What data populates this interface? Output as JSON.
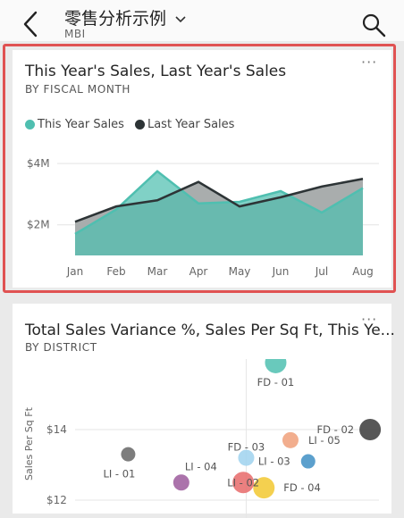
{
  "header": {
    "title": "零售分析示例",
    "subtitle": "MBI"
  },
  "colors": {
    "this_year": "#4fbfb0",
    "last_year": "#2d3436",
    "highlight": "#e05252"
  },
  "tile1": {
    "title": "This Year's Sales, Last Year's Sales",
    "subtitle": "BY FISCAL MONTH",
    "more": "···",
    "legend": [
      {
        "label": "This Year Sales",
        "color": "#4fbfb0"
      },
      {
        "label": "Last Year Sales",
        "color": "#2d3436"
      }
    ]
  },
  "chart_data": [
    {
      "type": "area",
      "categories": [
        "Jan",
        "Feb",
        "Mar",
        "Apr",
        "May",
        "Jun",
        "Jul",
        "Aug"
      ],
      "series": [
        {
          "name": "This Year Sales",
          "values": [
            1.7,
            2.5,
            3.75,
            2.7,
            2.75,
            3.1,
            2.4,
            3.2
          ]
        },
        {
          "name": "Last Year Sales",
          "values": [
            2.1,
            2.6,
            2.8,
            3.4,
            2.6,
            2.9,
            3.25,
            3.5
          ]
        }
      ],
      "yticks": [
        "$2M",
        "$4M"
      ],
      "ytick_values": [
        2,
        4
      ],
      "ylim": [
        1.0,
        4.5
      ],
      "grid": true,
      "legend_position": "top-left"
    },
    {
      "type": "scatter",
      "ylabel": "Sales Per Sq Ft",
      "yticks": [
        "$14",
        "$12"
      ],
      "ytick_values": [
        14,
        12
      ],
      "ylim": [
        12,
        16
      ],
      "points": [
        {
          "label": "FD - 01",
          "x": 1.0,
          "y": 15.9,
          "color": "#4fbfb0",
          "size": 12
        },
        {
          "label": "FD - 02",
          "x": 4.2,
          "y": 14.0,
          "color": "#3a3a3a",
          "size": 12
        },
        {
          "label": "LI - 05",
          "x": 1.5,
          "y": 13.7,
          "color": "#f0a07a",
          "size": 9
        },
        {
          "label": "LI - 03",
          "x": 2.1,
          "y": 13.1,
          "color": "#3f8fc4",
          "size": 8
        },
        {
          "label": "FD - 03",
          "x": 0.0,
          "y": 13.2,
          "color": "#9fd2ee",
          "size": 9
        },
        {
          "label": "LI - 01",
          "x": -4.0,
          "y": 13.3,
          "color": "#666666",
          "size": 8
        },
        {
          "label": "LI - 04",
          "x": -2.2,
          "y": 12.5,
          "color": "#9c5a9c",
          "size": 9
        },
        {
          "label": "LI - 02",
          "x": -0.1,
          "y": 12.5,
          "color": "#e86a6a",
          "size": 12
        },
        {
          "label": "FD - 04",
          "x": 0.6,
          "y": 12.35,
          "color": "#f2c830",
          "size": 12
        }
      ]
    }
  ],
  "tile2": {
    "title": "Total Sales Variance %, Sales Per Sq Ft, This Ye...",
    "subtitle": "BY DISTRICT",
    "more": "···"
  }
}
